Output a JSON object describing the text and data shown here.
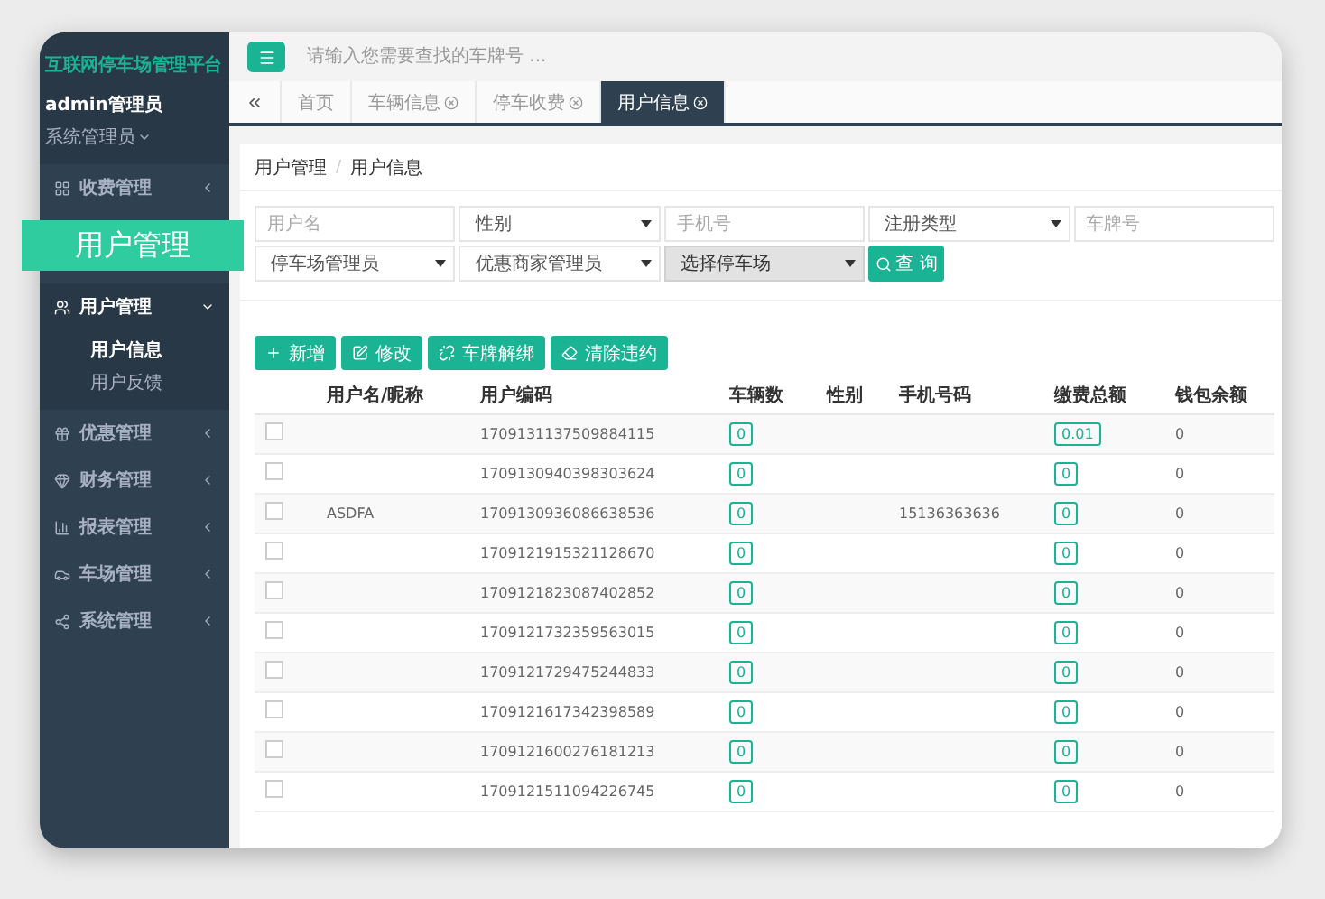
{
  "sidebar": {
    "title": "互联网停车场管理平台",
    "user": {
      "name": "admin管理员",
      "role": "系统管理员"
    },
    "menu": [
      {
        "label": "收费管理",
        "expanded": false
      },
      {
        "label": "用户管理",
        "expanded": true,
        "children": [
          {
            "label": "用户信息",
            "selected": true
          },
          {
            "label": "用户反馈",
            "selected": false
          }
        ]
      },
      {
        "label": "优惠管理",
        "expanded": false
      },
      {
        "label": "财务管理",
        "expanded": false
      },
      {
        "label": "报表管理",
        "expanded": false
      },
      {
        "label": "车场管理",
        "expanded": false
      },
      {
        "label": "系统管理",
        "expanded": false
      }
    ]
  },
  "callout": {
    "label": "用户管理"
  },
  "topbar": {
    "search_placeholder": "请输入您需要查找的车牌号 ..."
  },
  "tabs": [
    {
      "label": "首页",
      "selected": false,
      "closable": false
    },
    {
      "label": "车辆信息",
      "selected": false,
      "closable": true
    },
    {
      "label": "停车收费",
      "selected": false,
      "closable": true
    },
    {
      "label": "用户信息",
      "selected": true,
      "closable": true
    }
  ],
  "breadcrumb": {
    "items": [
      "用户管理",
      "用户信息"
    ],
    "separator": "/"
  },
  "filters": [
    {
      "kind": "input",
      "placeholder": "用户名",
      "disabled": false
    },
    {
      "kind": "select",
      "value": "性别",
      "disabled": false
    },
    {
      "kind": "input",
      "placeholder": "手机号",
      "disabled": false
    },
    {
      "kind": "select",
      "value": "注册类型",
      "disabled": false
    },
    {
      "kind": "input",
      "placeholder": "车牌号",
      "disabled": false
    },
    {
      "kind": "select",
      "value": "停车场管理员",
      "disabled": false
    },
    {
      "kind": "select",
      "value": "优惠商家管理员",
      "disabled": false
    },
    {
      "kind": "select",
      "value": "选择停车场",
      "disabled": true
    }
  ],
  "search_button": "查 询",
  "actions": [
    "新增",
    "修改",
    "车牌解绑",
    "清除违约"
  ],
  "table": {
    "columns": [
      "用户名/昵称",
      "用户编码",
      "车辆数",
      "性别",
      "手机号码",
      "缴费总额",
      "钱包余额"
    ],
    "rows": [
      {
        "checked": false,
        "name": "",
        "code": "1709131137509884115",
        "vehicles": "0",
        "gender": "",
        "phone": "",
        "fee": "0.01",
        "wallet": "0"
      },
      {
        "checked": false,
        "name": "",
        "code": "1709130940398303624",
        "vehicles": "0",
        "gender": "",
        "phone": "",
        "fee": "0",
        "wallet": "0"
      },
      {
        "checked": false,
        "name": "ASDFA",
        "code": "1709130936086638536",
        "vehicles": "0",
        "gender": "",
        "phone": "15136363636",
        "fee": "0",
        "wallet": "0"
      },
      {
        "checked": false,
        "name": "",
        "code": "1709121915321128670",
        "vehicles": "0",
        "gender": "",
        "phone": "",
        "fee": "0",
        "wallet": "0"
      },
      {
        "checked": false,
        "name": "",
        "code": "1709121823087402852",
        "vehicles": "0",
        "gender": "",
        "phone": "",
        "fee": "0",
        "wallet": "0"
      },
      {
        "checked": false,
        "name": "",
        "code": "1709121732359563015",
        "vehicles": "0",
        "gender": "",
        "phone": "",
        "fee": "0",
        "wallet": "0"
      },
      {
        "checked": false,
        "name": "",
        "code": "1709121729475244833",
        "vehicles": "0",
        "gender": "",
        "phone": "",
        "fee": "0",
        "wallet": "0"
      },
      {
        "checked": false,
        "name": "",
        "code": "1709121617342398589",
        "vehicles": "0",
        "gender": "",
        "phone": "",
        "fee": "0",
        "wallet": "0"
      },
      {
        "checked": false,
        "name": "",
        "code": "1709121600276181213",
        "vehicles": "0",
        "gender": "",
        "phone": "",
        "fee": "0",
        "wallet": "0"
      },
      {
        "checked": false,
        "name": "",
        "code": "1709121511094226745",
        "vehicles": "0",
        "gender": "",
        "phone": "",
        "fee": "0",
        "wallet": "0"
      }
    ]
  }
}
